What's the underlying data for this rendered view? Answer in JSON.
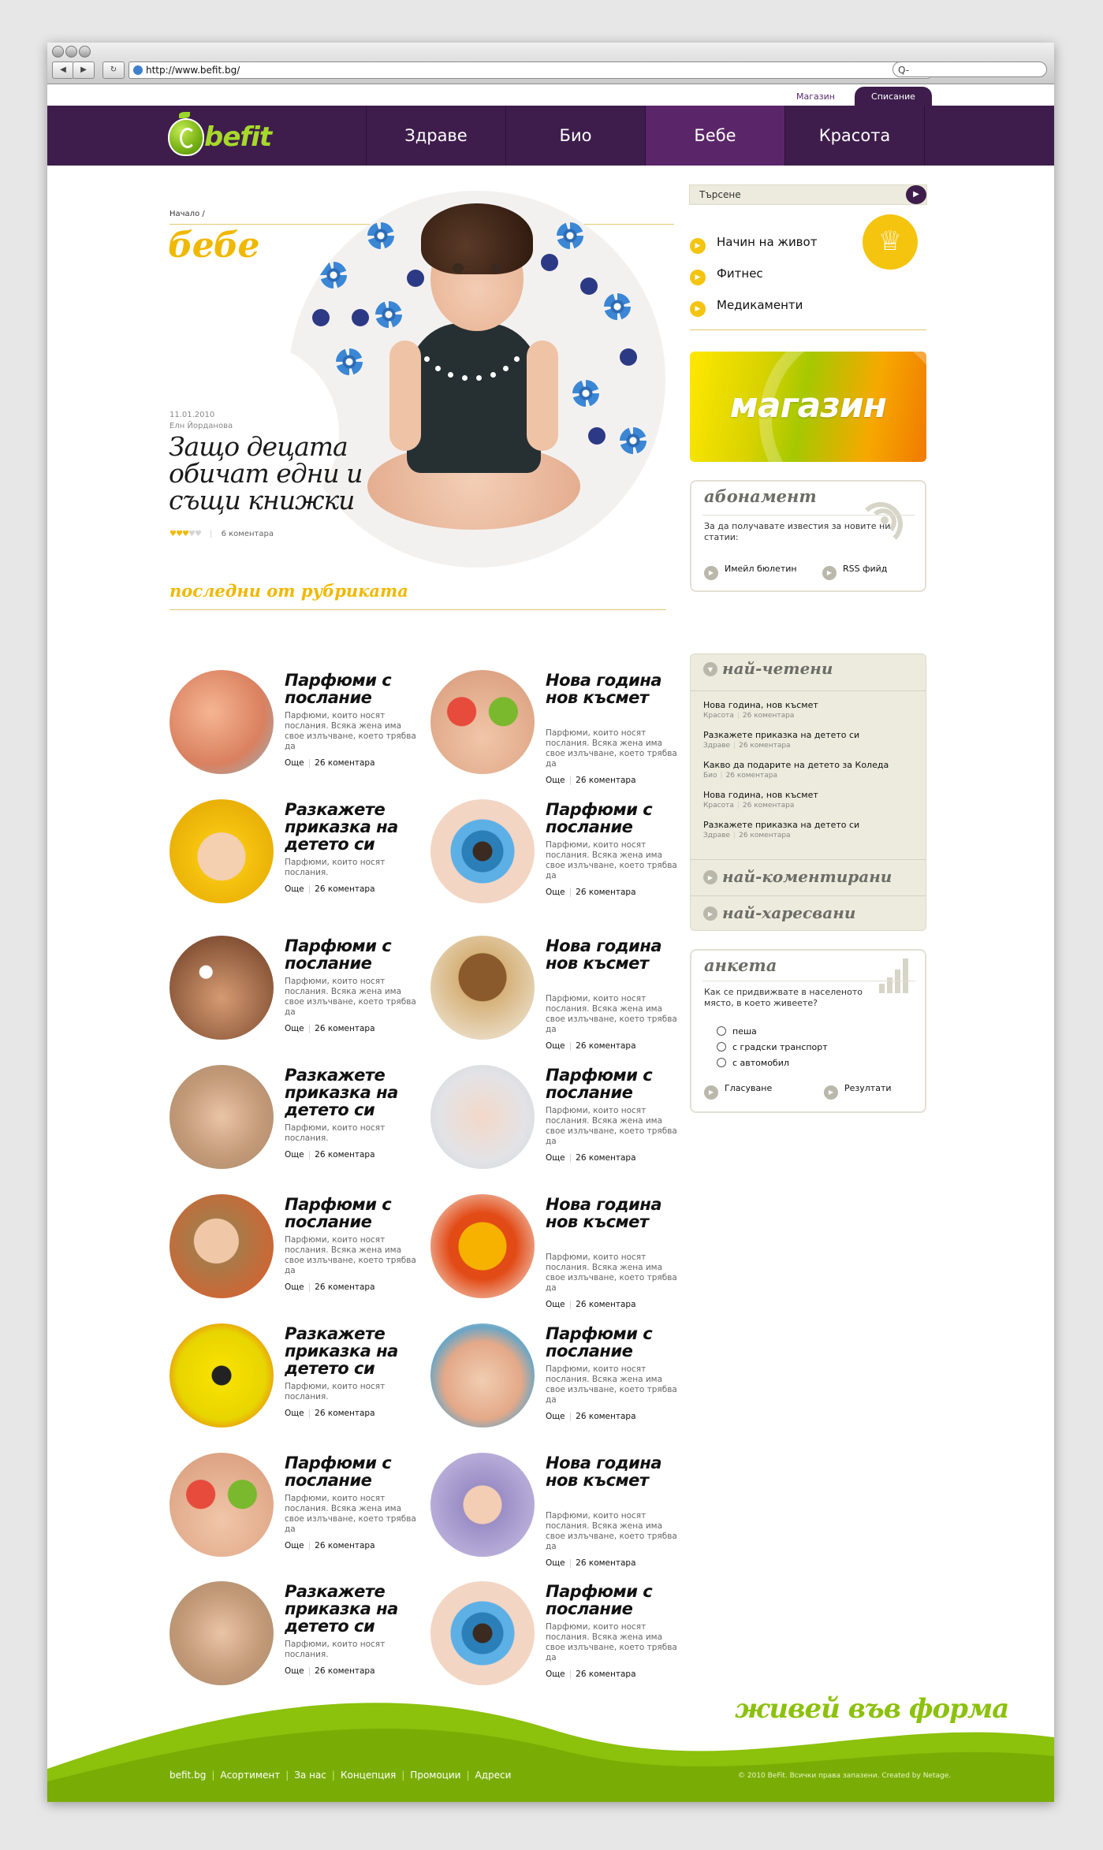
{
  "browser": {
    "url": "http://www.befit.bg/",
    "search_placeholder": "Q-",
    "back": "◀",
    "forward": "▶",
    "reload": "↻"
  },
  "topbar": {
    "shop": "Магазин",
    "magazine": "Списание"
  },
  "logo": {
    "text": "befit"
  },
  "nav": [
    "Здраве",
    "Био",
    "Бебе",
    "Красота"
  ],
  "breadcrumb": "Начало /",
  "section_title": "бебе",
  "hero": {
    "date": "11.01.2010",
    "author": "Елн Йорданова",
    "title": "Защо децата обичат едни и същи книжки",
    "comments": "6 коментара",
    "rating": 3,
    "rating_max": 5
  },
  "recent": {
    "title": "последни от рубриката",
    "more_label": "Още",
    "cards": [
      {
        "title": "Парфюми с послание",
        "desc": "Парфюми, които носят послания. Всяка жена има свое излъчване, което трябва да",
        "comments": "26 коментара"
      },
      {
        "title": "Нова година нов късмет",
        "desc": "Парфюми, които носят послания. Всяка жена има свое излъчване, което трябва да",
        "comments": "26 коментара"
      },
      {
        "title": "Разкажете приказка на детето си",
        "desc": "Парфюми, които носят послания.",
        "comments": "26 коментара"
      },
      {
        "title": "Парфюми с послание",
        "desc": "Парфюми, които носят послания. Всяка жена има свое излъчване, което трябва да",
        "comments": "26 коментара"
      },
      {
        "title": "Парфюми с послание",
        "desc": "Парфюми, които носят послания. Всяка жена има свое излъчване, което трябва да",
        "comments": "26 коментара"
      },
      {
        "title": "Нова година нов късмет",
        "desc": "Парфюми, които носят послания. Всяка жена има свое излъчване, което трябва да",
        "comments": "26 коментара"
      },
      {
        "title": "Разкажете приказка на детето си",
        "desc": "Парфюми, които носят послания.",
        "comments": "26 коментара"
      },
      {
        "title": "Парфюми с послание",
        "desc": "Парфюми, които носят послания. Всяка жена има свое излъчване, което трябва да",
        "comments": "26 коментара"
      },
      {
        "title": "Парфюми с послание",
        "desc": "Парфюми, които носят послания. Всяка жена има свое излъчване, което трябва да",
        "comments": "26 коментара"
      },
      {
        "title": "Нова година нов късмет",
        "desc": "Парфюми, които носят послания. Всяка жена има свое излъчване, което трябва да",
        "comments": "26 коментара"
      },
      {
        "title": "Разкажете приказка на детето си",
        "desc": "Парфюми, които носят послания.",
        "comments": "26 коментара"
      },
      {
        "title": "Парфюми с послание",
        "desc": "Парфюми, които носят послания. Всяка жена има свое излъчване, което трябва да",
        "comments": "26 коментара"
      },
      {
        "title": "Парфюми с послание",
        "desc": "Парфюми, които носят послания. Всяка жена има свое излъчване, което трябва да",
        "comments": "26 коментара"
      },
      {
        "title": "Нова година нов късмет",
        "desc": "Парфюми, които носят послания. Всяка жена има свое излъчване, което трябва да",
        "comments": "26 коментара"
      },
      {
        "title": "Разкажете приказка на детето си",
        "desc": "Парфюми, които носят послания.",
        "comments": "26 коментара"
      },
      {
        "title": "Парфюми с послание",
        "desc": "Парфюми, които носят послания. Всяка жена има свое излъчване, което трябва да",
        "comments": "26 коментара"
      }
    ]
  },
  "sidebar": {
    "search_placeholder": "Търсене",
    "subnav": [
      "Начин на живот",
      "Фитнес",
      "Медикаменти"
    ],
    "shop_banner": "магазин",
    "subscribe": {
      "title": "абонамент",
      "text": "За да получавате известия за новите ни статии:",
      "email": "Имейл бюлетин",
      "rss": "RSS фийд"
    },
    "most": {
      "read_title": "най-четени",
      "items": [
        {
          "title": "Нова година, нов късмет",
          "cat": "Красота",
          "comments": "26 коментара"
        },
        {
          "title": "Разкажете приказка на детето си",
          "cat": "Здраве",
          "comments": "26 коментара"
        },
        {
          "title": "Какво да подарите на детето за Коледа",
          "cat": "Био",
          "comments": "26 коментара"
        },
        {
          "title": "Нова година, нов късмет",
          "cat": "Красота",
          "comments": "26 коментара"
        },
        {
          "title": "Разкажете приказка на детето си",
          "cat": "Здраве",
          "comments": "26 коментара"
        }
      ],
      "commented_title": "най-коментирани",
      "liked_title": "най-харесвани"
    },
    "poll": {
      "title": "анкета",
      "question": "Как се придвижвате в населеното място, в което живеете?",
      "options": [
        "пеша",
        "с градски транспорт",
        "с автомобил"
      ],
      "vote": "Гласуване",
      "results": "Резултати"
    }
  },
  "footer": {
    "slogan": "живей във форма",
    "copyright": "© 2010 BeFit. Всички права запазени. Created by Netage.",
    "links": [
      "befit.bg",
      "Асортимент",
      "За нас",
      "Концепция",
      "Промоции",
      "Адреси"
    ]
  },
  "colors": {
    "purple": "#3e1d4c",
    "accent": "#f0b800",
    "green": "#8cc10c"
  }
}
